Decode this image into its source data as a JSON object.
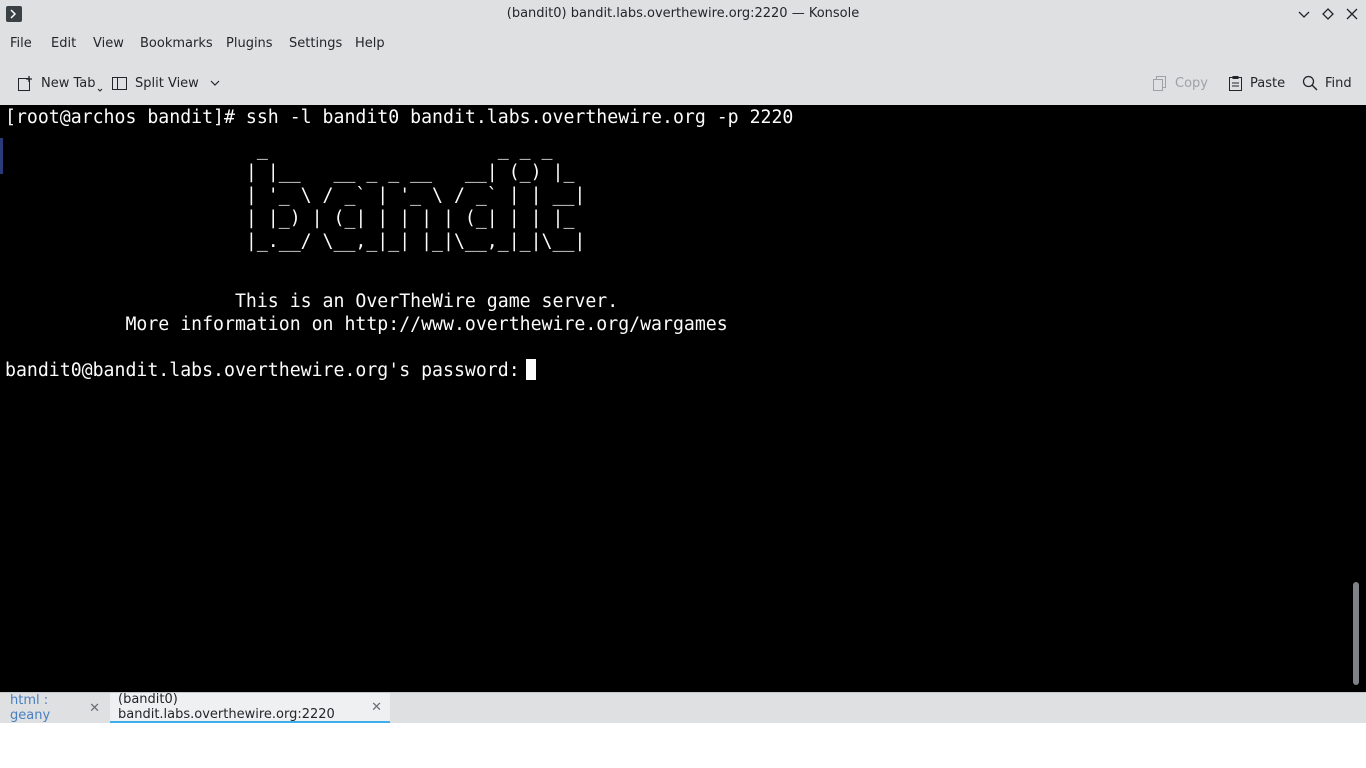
{
  "window": {
    "title": "(bandit0) bandit.labs.overthewire.org:2220 — Konsole",
    "app_icon": "terminal-icon",
    "controls": [
      "minimize-icon",
      "maximize-icon",
      "close-icon"
    ]
  },
  "menubar": {
    "items": [
      "File",
      "Edit",
      "View",
      "Bookmarks",
      "Plugins",
      "Settings",
      "Help"
    ]
  },
  "toolbar": {
    "new_tab": "New Tab",
    "split_view": "Split View",
    "copy": "Copy",
    "paste": "Paste",
    "find": "Find"
  },
  "terminal": {
    "command_line": "[root@archos bandit]# ssh -l bandit0 bandit.labs.overthewire.org -p 2220",
    "ascii_art": "                       _                     _ _ _\n                      | |__   __ _ _ __   __| (_) |_\n                      | '_ \\ / _` | '_ \\ / _` | | __|\n                      | |_) | (_| | | | | (_| | | |_\n                      |_.__/ \\__,_|_| |_|\\__,_|_|\\__|",
    "banner_line1": "                     This is an OverTheWire game server.",
    "banner_line2": "           More information on http://www.overthewire.org/wargames",
    "password_prompt": "bandit0@bandit.labs.overthewire.org's password:",
    "background": "#000000",
    "foreground": "#fcfcfc"
  },
  "tabs": [
    {
      "label": "html : geany",
      "active": false
    },
    {
      "label": "(bandit0) bandit.labs.overthewire.org:2220",
      "active": true
    }
  ],
  "colors": {
    "chrome": "#dee0e2",
    "accent": "#3daee9",
    "inactive_tab_text": "#4a7fbf"
  }
}
